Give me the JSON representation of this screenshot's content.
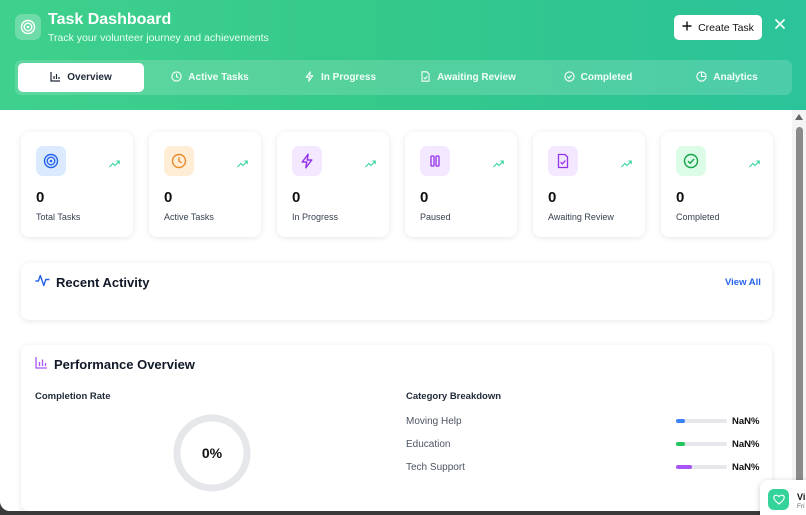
{
  "header": {
    "title": "Task Dashboard",
    "subtitle": "Track your volunteer journey and achievements",
    "create_label": "Create Task",
    "logo_icon": "target-icon",
    "close_icon": "close-icon"
  },
  "tabs": [
    {
      "label": "Overview",
      "icon": "bar-chart-icon",
      "active": true
    },
    {
      "label": "Active Tasks",
      "icon": "clock-icon",
      "active": false
    },
    {
      "label": "In Progress",
      "icon": "lightning-icon",
      "active": false
    },
    {
      "label": "Awaiting Review",
      "icon": "document-check-icon",
      "active": false
    },
    {
      "label": "Completed",
      "icon": "check-circle-icon",
      "active": false
    },
    {
      "label": "Analytics",
      "icon": "pie-chart-icon",
      "active": false
    }
  ],
  "stats": [
    {
      "value": "0",
      "label": "Total Tasks",
      "icon": "target-icon",
      "color": "#2563eb",
      "bg": "#dbeafe"
    },
    {
      "value": "0",
      "label": "Active Tasks",
      "icon": "clock-icon",
      "color": "#ea8a2c",
      "bg": "#ffedd5"
    },
    {
      "value": "0",
      "label": "In Progress",
      "icon": "lightning-icon",
      "color": "#9333ea",
      "bg": "#f3e8ff"
    },
    {
      "value": "0",
      "label": "Paused",
      "icon": "pause-icon",
      "color": "#9333ea",
      "bg": "#f3e8ff"
    },
    {
      "value": "0",
      "label": "Awaiting Review",
      "icon": "document-check-icon",
      "color": "#9333ea",
      "bg": "#f3e8ff"
    },
    {
      "value": "0",
      "label": "Completed",
      "icon": "check-circle-icon",
      "color": "#16a34a",
      "bg": "#dcfce7"
    }
  ],
  "recent_activity": {
    "title": "Recent Activity",
    "view_all": "View All"
  },
  "performance": {
    "title": "Performance Overview",
    "completion_label": "Completion Rate",
    "completion_value": "0%",
    "category_label": "Category Breakdown",
    "categories": [
      {
        "name": "Moving Help",
        "pct": "NaN%",
        "color": "#3b82f6"
      },
      {
        "name": "Education",
        "pct": "NaN%",
        "color": "#22c55e"
      },
      {
        "name": "Tech Support",
        "pct": "NaN%",
        "color": "#a855f7"
      }
    ]
  },
  "toast": {
    "title": "Vi",
    "subtitle": "Fri"
  }
}
